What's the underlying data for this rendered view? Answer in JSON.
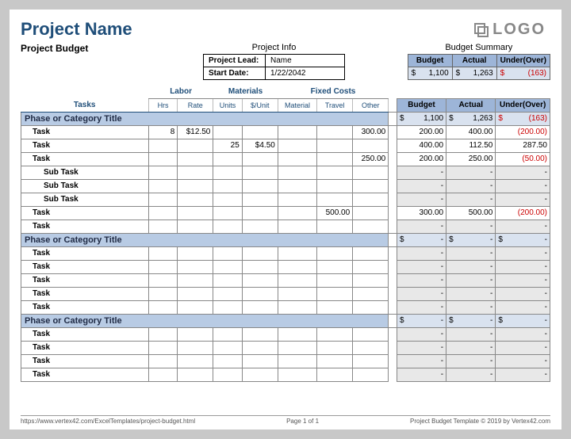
{
  "title": "Project Name",
  "subtitle": "Project Budget",
  "logo_text": "LOGO",
  "project_info": {
    "heading": "Project Info",
    "lead_label": "Project Lead:",
    "lead_value": "Name",
    "date_label": "Start Date:",
    "date_value": "1/22/2042"
  },
  "budget_summary": {
    "heading": "Budget Summary",
    "hdr_budget": "Budget",
    "hdr_actual": "Actual",
    "hdr_uo": "Under(Over)",
    "budget": "1,100",
    "actual": "1,263",
    "uo": "(163)"
  },
  "group_headers": {
    "labor": "Labor",
    "materials": "Materials",
    "fixed": "Fixed Costs"
  },
  "col_headers": {
    "tasks": "Tasks",
    "hrs": "Hrs",
    "rate": "Rate",
    "units": "Units",
    "unitprice": "$/Unit",
    "material": "Material",
    "travel": "Travel",
    "other": "Other",
    "budget": "Budget",
    "actual": "Actual",
    "uo": "Under(Over)"
  },
  "phase_label": "Phase or Category Title",
  "task_label": "Task",
  "subtask_label": "Sub Task",
  "phase1_totals": {
    "budget": "1,100",
    "actual": "1,263",
    "uo": "(163)"
  },
  "rows": {
    "r1": {
      "hrs": "8",
      "rate": "$12.50",
      "other": "300.00",
      "budget": "200.00",
      "actual": "400.00",
      "uo": "(200.00)"
    },
    "r2": {
      "units": "25",
      "uprice": "$4.50",
      "budget": "400.00",
      "actual": "112.50",
      "uo": "287.50"
    },
    "r3": {
      "other": "250.00",
      "budget": "200.00",
      "actual": "250.00",
      "uo": "(50.00)"
    },
    "r4": {
      "travel": "500.00",
      "budget": "300.00",
      "actual": "500.00",
      "uo": "(200.00)"
    }
  },
  "dash": "-",
  "dollar": "$",
  "phase_empty_sum": "-",
  "footer": {
    "left": "https://www.vertex42.com/ExcelTemplates/project-budget.html",
    "center": "Page 1 of 1",
    "right": "Project Budget Template © 2019 by Vertex42.com"
  }
}
